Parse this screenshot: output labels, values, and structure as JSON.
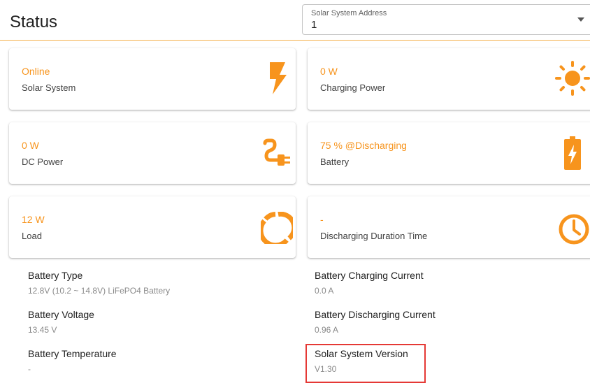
{
  "header": {
    "title": "Status",
    "address_select": {
      "label": "Solar System Address",
      "value": "1"
    }
  },
  "colors": {
    "accent": "#f7941d",
    "highlight": "#e53935"
  },
  "cards": [
    {
      "value": "Online",
      "label": "Solar System",
      "icon": "lightning-bolt-icon"
    },
    {
      "value": "0 W",
      "label": "Charging Power",
      "icon": "sun-icon"
    },
    {
      "value": "0 W",
      "label": "DC Power",
      "icon": "power-plug-icon"
    },
    {
      "value": "75 % @Discharging",
      "label": "Battery",
      "icon": "battery-charging-icon"
    },
    {
      "value": "12 W",
      "label": "Load",
      "icon": "donut-chart-icon"
    },
    {
      "value": "-",
      "label": "Discharging Duration Time",
      "icon": "clock-icon"
    }
  ],
  "details": {
    "left": [
      {
        "label": "Battery Type",
        "value": "12.8V (10.2 ~ 14.8V) LiFePO4 Battery"
      },
      {
        "label": "Battery Voltage",
        "value": "13.45 V"
      },
      {
        "label": "Battery Temperature",
        "value": "-"
      }
    ],
    "right": [
      {
        "label": "Battery Charging Current",
        "value": "0.0 A"
      },
      {
        "label": "Battery Discharging Current",
        "value": "0.96 A"
      },
      {
        "label": "Solar System Version",
        "value": "V1.30"
      }
    ]
  }
}
